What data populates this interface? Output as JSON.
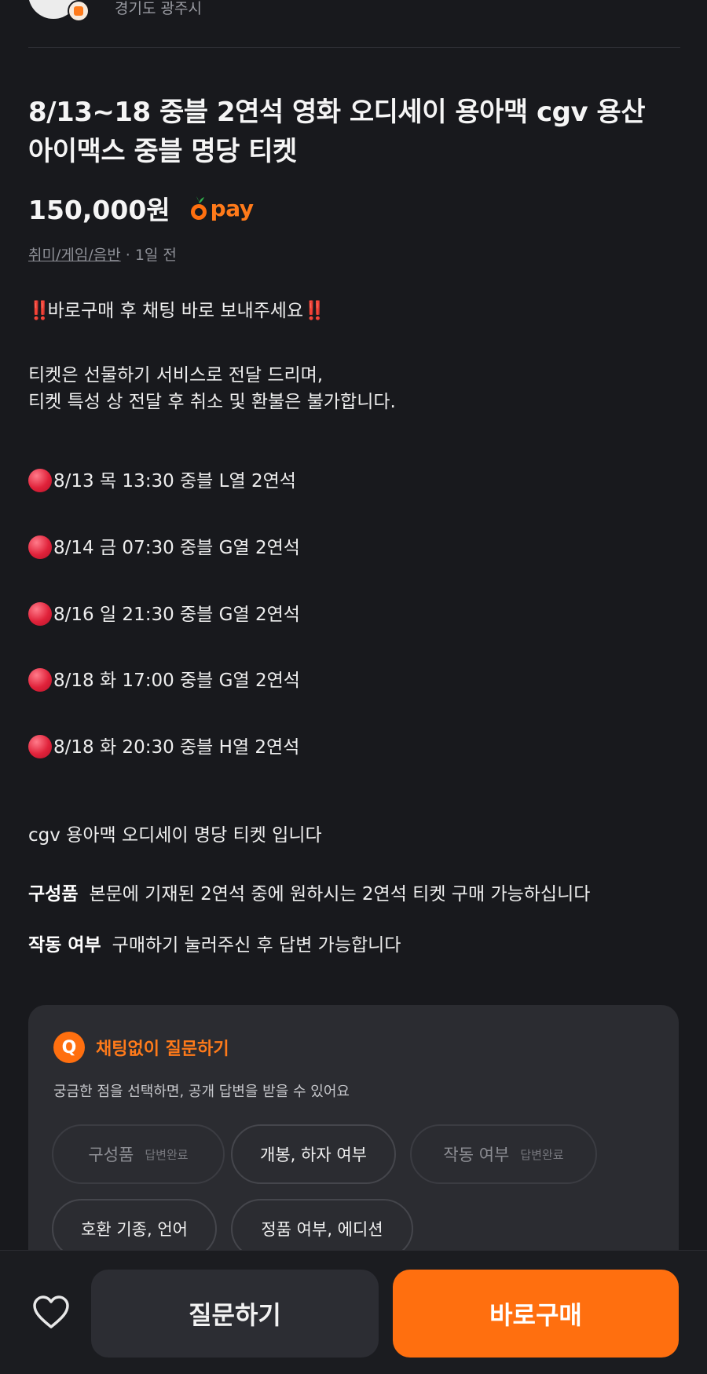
{
  "seller": {
    "location": "경기도 광주시"
  },
  "listing": {
    "title": "8/13~18 중블 2연석 영화 오디세이 용아맥 cgv 용산 아이맥스 중블 명당 티켓",
    "price": "150,000원",
    "pay_label": "pay",
    "category": "취미/게임/음반",
    "time_ago": "· 1일 전"
  },
  "description": {
    "notice": "바로구매 후 채팅 바로 보내주세요",
    "notice_emoji": "‼️",
    "para1_line1": "티켓은 선물하기 서비스로 전달 드리며,",
    "para1_line2": "티켓 특성 상 전달 후 취소 및 환불은 불가합니다.",
    "showtimes": [
      "8/13 목 13:30 중블 L열 2연석",
      "8/14 금 07:30 중블 G열 2연석",
      "8/16 일 21:30 중블 G열 2연석",
      "8/18 화 17:00 중블 G열 2연석",
      "8/18 화 20:30 중블 H열 2연석"
    ],
    "closing": "cgv 용아맥 오디세이 명당 티켓 입니다",
    "spec1_label": "구성품",
    "spec1_value": "본문에 기재된 2연석 중에 원하시는 2연석 티켓 구매 가능하십니다",
    "spec2_label": "작동 여부",
    "spec2_value": "구매하기 눌러주신 후 답변 가능합니다"
  },
  "qa": {
    "icon_letter": "Q",
    "title": "채팅없이 질문하기",
    "subtitle": "궁금한 점을 선택하면, 공개 답변을 받을 수 있어요",
    "chips": [
      {
        "label": "구성품",
        "status": "답변완료"
      },
      {
        "label": "개봉, 하자 여부",
        "status": ""
      },
      {
        "label": "작동 여부",
        "status": "답변완료"
      },
      {
        "label": "호환 기종, 언어",
        "status": ""
      },
      {
        "label": "정품 여부, 에디션",
        "status": ""
      }
    ]
  },
  "bottom": {
    "ask_label": "질문하기",
    "buy_label": "바로구매"
  },
  "colors": {
    "accent": "#ff6f0f",
    "background": "#18191d",
    "card": "#2b2c31",
    "alert_red": "#e0223a"
  },
  "icons": {
    "like": "heart-outline-icon",
    "pay": "carrot-pay-icon",
    "qa": "q-bubble-icon",
    "showtime": "red-circle-emoji"
  }
}
